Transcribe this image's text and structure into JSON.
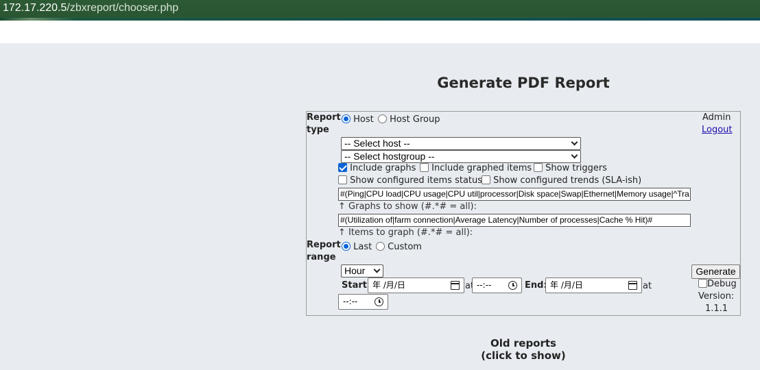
{
  "browser": {
    "url_host": "172.17.220.5",
    "url_path": "/zbxreport/chooser.php"
  },
  "page": {
    "title": "Generate PDF Report"
  },
  "form": {
    "report_type_label_1": "Report",
    "report_type_label_2": "type",
    "report_type_options": [
      "Host",
      "Host Group"
    ],
    "report_type_selected": "Host",
    "host_select": "-- Select host --",
    "hostgroup_select": "-- Select hostgroup --",
    "checkboxes": [
      {
        "label": "Include graphs",
        "checked": true
      },
      {
        "label": "Include graphed items",
        "checked": false
      },
      {
        "label": "Show triggers",
        "checked": false
      },
      {
        "label": "Show configured items status",
        "checked": false
      },
      {
        "label": "Show configured trends (SLA-ish)",
        "checked": false
      }
    ],
    "graphs_filter_value": "#(Ping|CPU load|CPU usage|CPU util|processor|Disk space|Swap|Ethernet|Memory usage|^Tra",
    "graphs_filter_hint": "↑ Graphs to show (#.*# = all):",
    "items_filter_value": "#(Utilization of|farm connection|Average Latency|Number of processes|Cache % Hit)#",
    "items_filter_hint": "↑ Items to graph (#.*# = all):",
    "report_range_label_1": "Report",
    "report_range_label_2": "range",
    "range_options": [
      "Last",
      "Custom"
    ],
    "range_selected": "Last",
    "period_select": "Hour",
    "start_label": "Start:",
    "end_label": "End:",
    "at_label": "at",
    "date_placeholder": "年 /月/日",
    "time_placeholder": "--:--"
  },
  "side": {
    "user": "Admin",
    "logout": "Logout",
    "generate_button": "Generate",
    "debug_label": "Debug",
    "debug_checked": false,
    "version_label": "Version:",
    "version_value": "1.1.1"
  },
  "old_reports": {
    "line1": "Old reports",
    "line2": "(click to show)"
  },
  "colors": {
    "accent": "#0b63d6",
    "url_bar": "#2c5a34",
    "page_bg": "#e8ecf0"
  }
}
